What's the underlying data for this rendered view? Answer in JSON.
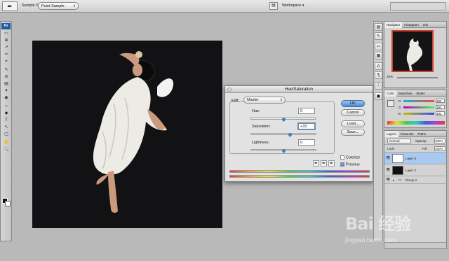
{
  "options_bar": {
    "tool_icon": "eyedropper-icon",
    "sample_label": "Sample Size:",
    "sample_value": "Point Sample",
    "workspace_label": "Workspace"
  },
  "tools": {
    "logo": "Ps",
    "items": [
      "▭",
      "⊕",
      "↗",
      "✂",
      "⌖",
      "✎",
      "⊘",
      "▤",
      "✦",
      "◉",
      "○",
      "◆",
      "T",
      "↖",
      "▢",
      "✋",
      "🔍"
    ]
  },
  "dialog": {
    "title": "Hue/Saturation",
    "edit_label": "Edit:",
    "edit_value": "Master",
    "hue_label": "Hue:",
    "hue_value": "0",
    "saturation_label": "Saturation:",
    "saturation_value": "+33",
    "lightness_label": "Lightness:",
    "lightness_value": "0",
    "ok_label": "OK",
    "cancel_label": "Cancel",
    "load_label": "Load...",
    "save_label": "Save...",
    "colorize_label": "Colorize",
    "preview_label": "Preview",
    "sliders": {
      "hue": 0.5,
      "saturation": 0.6,
      "lightness": 0.5
    }
  },
  "navigator": {
    "tabs": [
      "Navigator",
      "Histogram",
      "Info"
    ],
    "zoom": "25%"
  },
  "color_panel": {
    "tabs": [
      "Color",
      "Swatches",
      "Styles"
    ],
    "channels": [
      {
        "label": "R",
        "value": "192"
      },
      {
        "label": "G",
        "value": "192"
      },
      {
        "label": "B",
        "value": "192"
      }
    ]
  },
  "layers_panel": {
    "tabs": [
      "Layers",
      "Channels",
      "Paths"
    ],
    "blend_mode": "Normal",
    "opacity_label": "Opacity:",
    "opacity_value": "100%",
    "lock_label": "Lock:",
    "fill_label": "Fill:",
    "fill_value": "100%",
    "layers": [
      {
        "name": "Layer 4",
        "selected": true
      },
      {
        "name": "Layer 2",
        "selected": false
      }
    ],
    "group_name": "Group 1"
  },
  "watermark": {
    "logo": "Bai 经验",
    "url": "jingyan.baidu.com"
  }
}
